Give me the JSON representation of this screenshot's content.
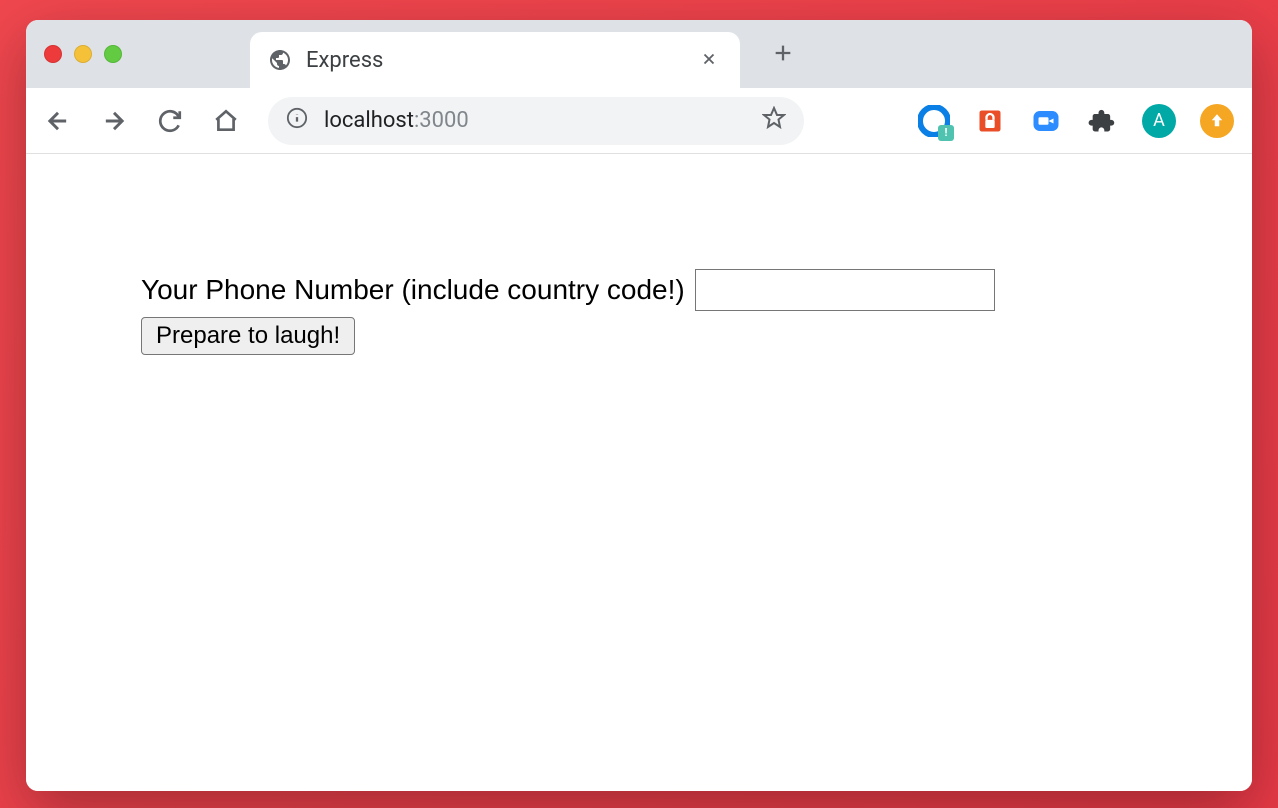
{
  "tab": {
    "title": "Express"
  },
  "url": {
    "host": "localhost",
    "port": ":3000"
  },
  "avatar": {
    "letter": "A"
  },
  "page": {
    "form": {
      "phone_label": "Your Phone Number (include country code!)",
      "submit_label": "Prepare to laugh!"
    }
  }
}
